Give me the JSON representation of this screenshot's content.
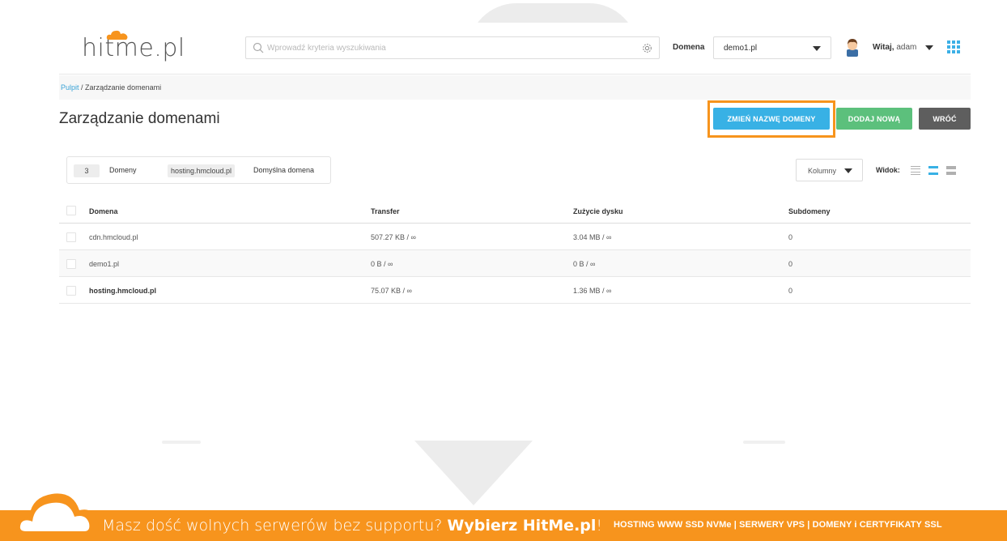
{
  "header": {
    "logo_prefix": "hit",
    "logo_suffix": "me.pl",
    "search_placeholder": "Wprowadź kryteria wyszukiwania",
    "domain_label": "Domena",
    "domain_selected": "demo1.pl",
    "greeting_prefix": "Witaj,",
    "greeting_user": "adam"
  },
  "breadcrumb": {
    "home": "Pulpit",
    "separator": " / ",
    "current": "Zarządzanie domenami"
  },
  "page": {
    "title": "Zarządzanie domenami",
    "buttons": {
      "rename": "ZMIEŃ NAZWĘ DOMENY",
      "add": "DODAJ NOWĄ",
      "back": "WRÓĆ"
    }
  },
  "stats": {
    "count": "3",
    "count_label": "Domeny",
    "default_domain": "hosting.hmcloud.pl",
    "default_label": "Domyślna domena"
  },
  "toolbar": {
    "columns_label": "Kolumny",
    "view_label": "Widok:"
  },
  "table": {
    "headers": [
      "Domena",
      "Transfer",
      "Zużycie dysku",
      "Subdomeny"
    ],
    "rows": [
      {
        "domain": "cdn.hmcloud.pl",
        "transfer": "507.27 KB / ∞",
        "disk": "3.04 MB / ∞",
        "subdomains": "0"
      },
      {
        "domain": "demo1.pl",
        "transfer": "0 B / ∞",
        "disk": "0 B / ∞",
        "subdomains": "0"
      },
      {
        "domain": "hosting.hmcloud.pl",
        "transfer": "75.07 KB / ∞",
        "disk": "1.36 MB / ∞",
        "subdomains": "0"
      }
    ]
  },
  "footer": {
    "message_light": "Masz dość wolnych serwerów bez supportu?",
    "message_bold": "Wybierz HitMe.pl",
    "message_end": "!",
    "services": "HOSTING WWW SSD NVMe | SERWERY VPS | DOMENY i CERTYFIKATY SSL"
  },
  "colors": {
    "accent_blue": "#38b1e5",
    "accent_green": "#5cc07c",
    "back_grey": "#5e5e5e",
    "brand_orange": "#f7941d"
  },
  "icons": [
    "search-icon",
    "gear-icon",
    "chevron-down-icon",
    "avatar",
    "apps-grid-icon",
    "cloud-logo-icon",
    "view-list-icon"
  ]
}
